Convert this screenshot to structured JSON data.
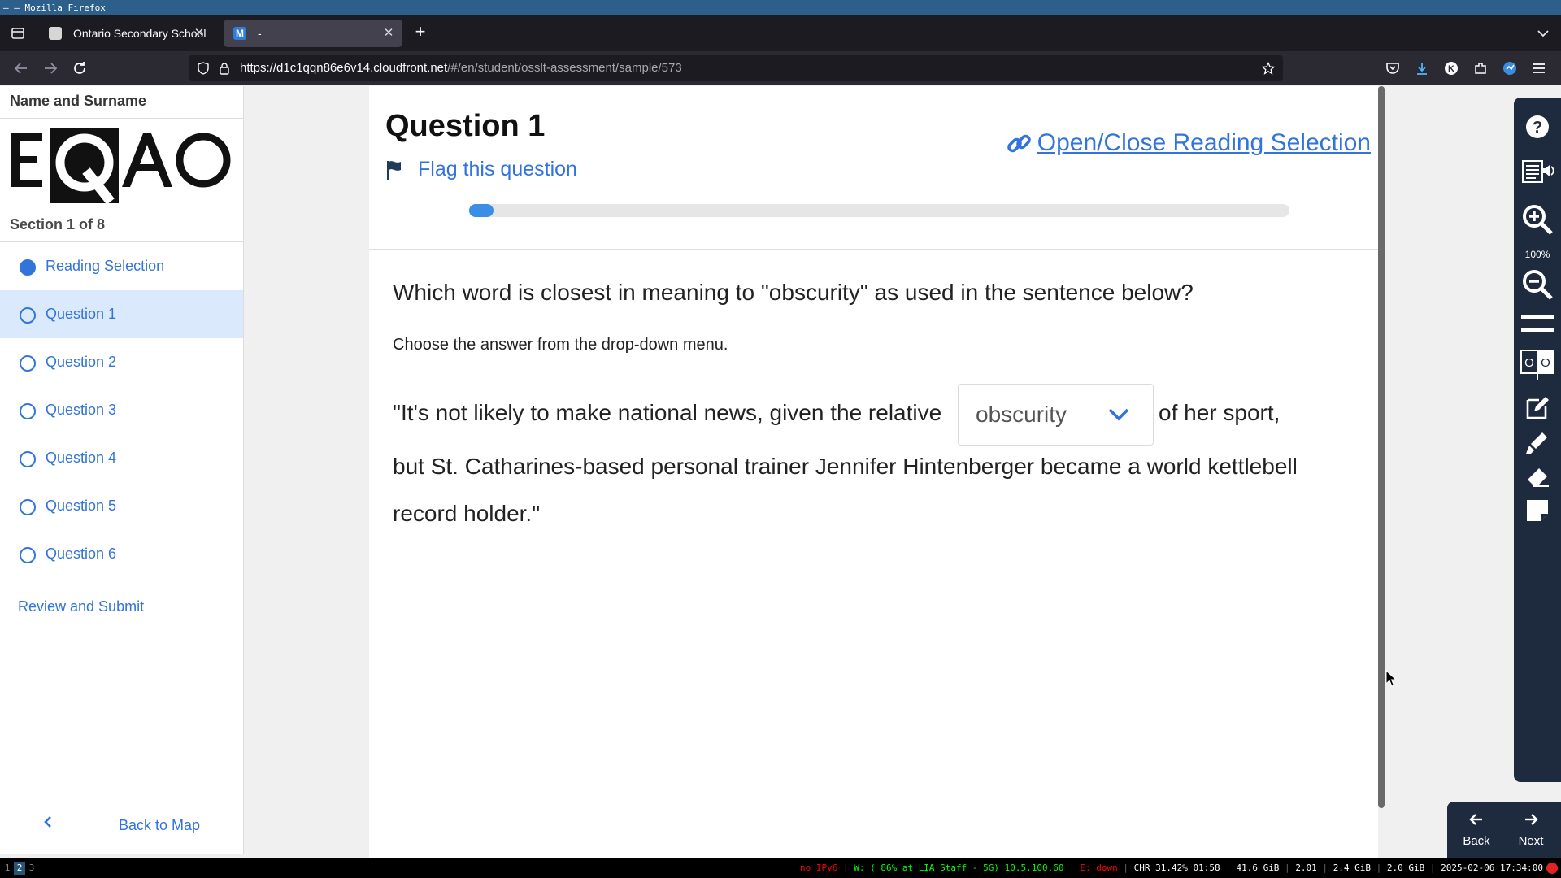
{
  "window": {
    "title": "– — Mozilla Firefox"
  },
  "browser": {
    "tabs": [
      {
        "title": "Ontario Secondary School"
      },
      {
        "title": "-"
      }
    ],
    "url": {
      "host": "https://d1c1qqn86e6v14.cloudfront.net",
      "path": "/#/en/student/osslt-assessment/sample/573"
    }
  },
  "sidebar": {
    "student_name": "Name and Surname",
    "logo_text": "EQAO",
    "section_label": "Section 1 of 8",
    "items": [
      {
        "label": "Reading Selection"
      },
      {
        "label": "Question 1"
      },
      {
        "label": "Question 2"
      },
      {
        "label": "Question 3"
      },
      {
        "label": "Question 4"
      },
      {
        "label": "Question 5"
      },
      {
        "label": "Question 6"
      }
    ],
    "review_submit": "Review and Submit",
    "back_to_map": "Back to Map"
  },
  "question": {
    "title": "Question 1",
    "flag_label": "Flag this question",
    "open_reading_label": "Open/Close Reading Selection",
    "progress_fraction": 0.03,
    "prompt": "Which word is closest in meaning to \"obscurity\" as used in the sentence below?",
    "instruction": "Choose the answer from the drop-down menu.",
    "passage_part1": "\"It's not likely to make national news, given the relative",
    "dropdown_value": "obscurity",
    "passage_part2": "of her sport,",
    "passage_line2": "but St. Catharines-based personal trainer Jennifer Hintenberger became a world kettlebell",
    "passage_line3": "record holder.\""
  },
  "tools": {
    "zoom_level": "100%",
    "back_label": "Back",
    "next_label": "Next"
  },
  "statusbar": {
    "workspaces": [
      "1",
      "2",
      "3"
    ],
    "ipv6": "no IPv6",
    "wifi": "W: ( 86% at LIA Staff - 5G) 10.5.100.60",
    "ethernet": "E: down",
    "cpu": "CHR 31.42% 01:58",
    "disk": "41.6 GiB",
    "load": "2.01",
    "mem": "2.4 GiB",
    "swap": "2.0 GiB",
    "datetime": "2025-02-06 17:34:00"
  },
  "colors": {
    "accent": "#3273dc",
    "active_item": "#daeafc",
    "toolbar": "#1e2a3e",
    "progress": "#3a8ee6"
  }
}
